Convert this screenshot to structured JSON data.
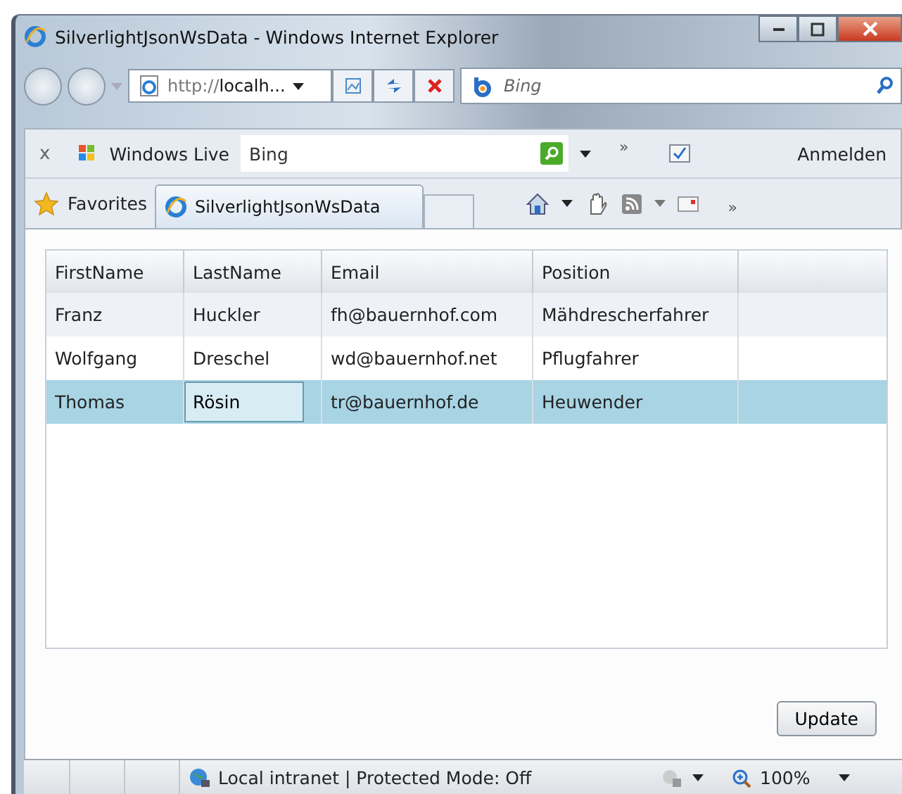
{
  "window": {
    "title": "SilverlightJsonWsData - Windows Internet Explorer"
  },
  "address_bar": {
    "url_prefix": "http://",
    "url_host": "localh...",
    "search_placeholder": "Bing"
  },
  "links_toolbar": {
    "close": "x",
    "name": "Windows Live",
    "search_value": "Bing",
    "overflow": "»",
    "sign_in": "Anmelden"
  },
  "favorites_bar": {
    "favorites": "Favorites",
    "overflow": "»",
    "tabs": [
      {
        "label": "SilverlightJsonWsData",
        "selected": true
      }
    ]
  },
  "table": {
    "columns": [
      "FirstName",
      "LastName",
      "Email",
      "Position"
    ],
    "rows": [
      {
        "selected": false,
        "cells": [
          {
            "text": "Franz",
            "editing": false
          },
          {
            "text": "Huckler",
            "editing": false
          },
          {
            "text": "fh@bauernhof.com",
            "editing": false
          },
          {
            "text": "Mähdrescherfahrer",
            "editing": false
          }
        ]
      },
      {
        "selected": false,
        "cells": [
          {
            "text": "Wolfgang",
            "editing": false
          },
          {
            "text": "Dreschel",
            "editing": false
          },
          {
            "text": "wd@bauernhof.net",
            "editing": false
          },
          {
            "text": "Pflugfahrer",
            "editing": false
          }
        ]
      },
      {
        "selected": true,
        "cells": [
          {
            "text": "Thomas",
            "editing": false
          },
          {
            "text": "Rösin",
            "editing": true
          },
          {
            "text": "tr@bauernhof.de",
            "editing": false
          },
          {
            "text": "Heuwender",
            "editing": false
          }
        ]
      }
    ]
  },
  "buttons": [
    "Update"
  ],
  "status_bar": {
    "zone": "Local intranet | Protected Mode: Off",
    "zoom": "100%"
  }
}
